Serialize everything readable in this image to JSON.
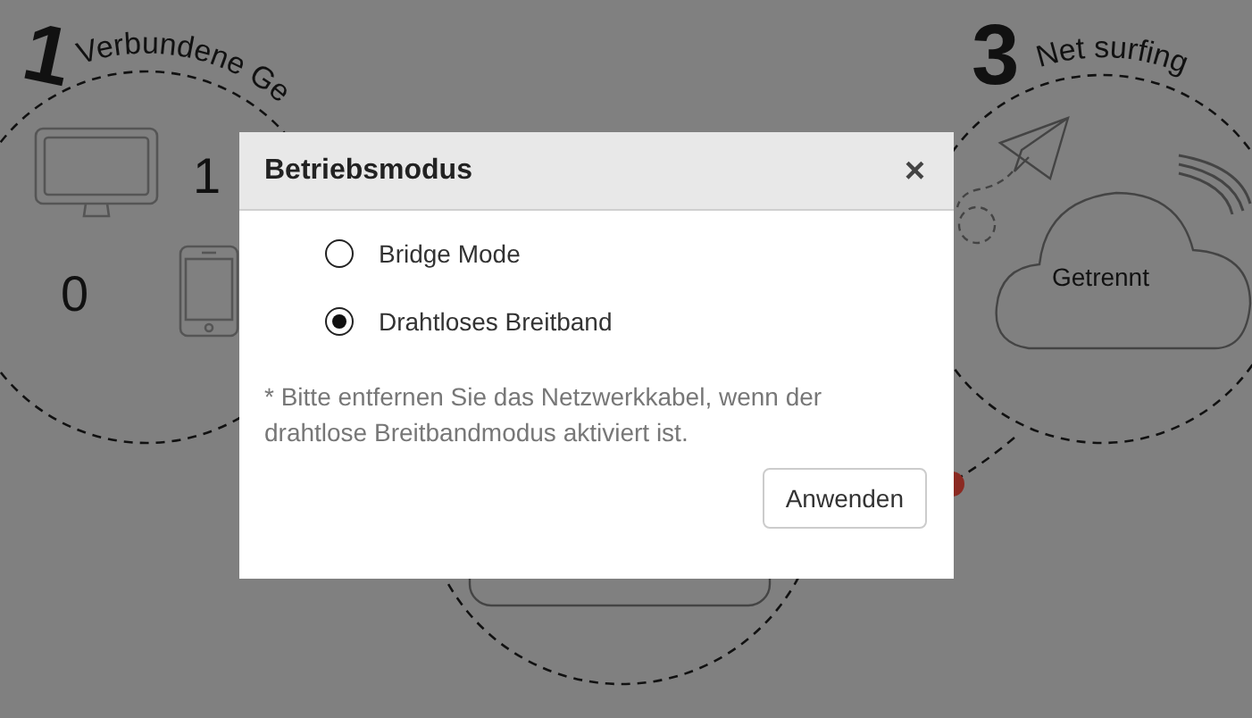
{
  "background": {
    "step_1": {
      "number": "1",
      "title": "Verbundene Ge"
    },
    "devices": [
      {
        "kind": "computer",
        "count": "1"
      },
      {
        "kind": "phone",
        "count": "0"
      }
    ],
    "step_3": {
      "number": "3",
      "title": "Net surfing"
    },
    "internet_status": "Getrennt"
  },
  "dialog": {
    "title": "Betriebsmodus",
    "close": "×",
    "options": [
      {
        "label": "Bridge Mode",
        "selected": false
      },
      {
        "label": "Drahtloses Breitband",
        "selected": true
      }
    ],
    "note": "* Bitte entfernen Sie das Netzwerkkabel, wenn der drahtlose Breitbandmodus aktiviert ist.",
    "apply_button": "Anwenden"
  }
}
